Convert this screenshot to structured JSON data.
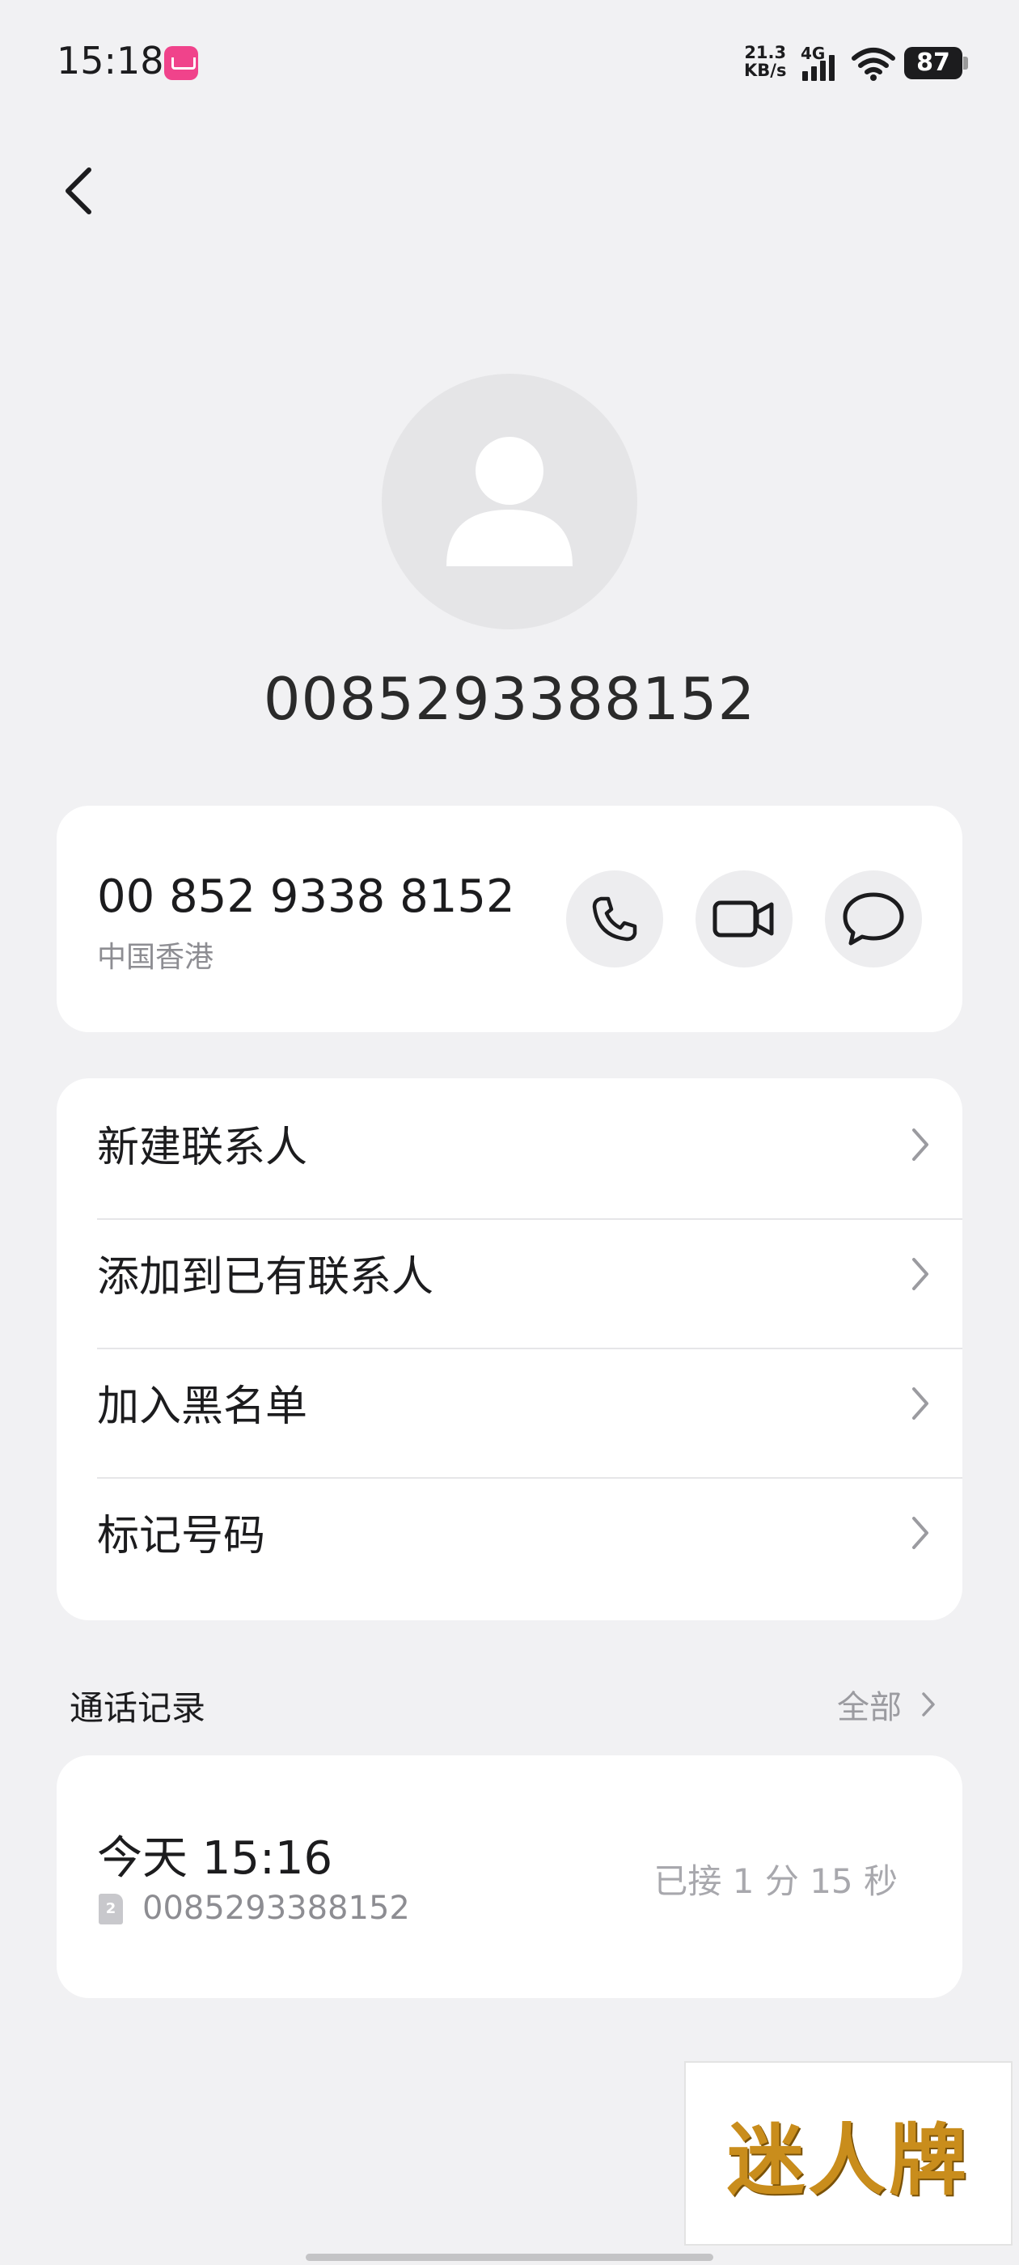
{
  "status_bar": {
    "time": "15:18",
    "net_speed_value": "21.3",
    "net_speed_unit": "KB/s",
    "network_type": "4G",
    "battery": "87",
    "icons": [
      "app-notification-icon",
      "signal-icon",
      "wifi-icon",
      "battery-icon"
    ]
  },
  "header": {
    "back_icon": "chevron-left-icon",
    "avatar_icon": "person-icon",
    "title": "0085293388152"
  },
  "phone_card": {
    "formatted_number": "00 852 9338 8152",
    "region": "中国香港",
    "actions": [
      {
        "name": "call",
        "icon": "phone-icon"
      },
      {
        "name": "video-call",
        "icon": "video-camera-icon"
      },
      {
        "name": "message",
        "icon": "message-bubble-icon"
      }
    ]
  },
  "actions": [
    {
      "label": "新建联系人"
    },
    {
      "label": "添加到已有联系人"
    },
    {
      "label": "加入黑名单"
    },
    {
      "label": "标记号码"
    }
  ],
  "call_log": {
    "title": "通话记录",
    "all_label": "全部",
    "entries": [
      {
        "time": "今天 15:16",
        "sim": "2",
        "number": "0085293388152",
        "status": "已接 1 分 15 秒"
      }
    ]
  },
  "watermark": {
    "text": "迷人牌"
  },
  "colors": {
    "background": "#f1f1f3",
    "card": "#ffffff",
    "secondary_text": "#8d8d92",
    "watermark": "#c98d1c"
  }
}
